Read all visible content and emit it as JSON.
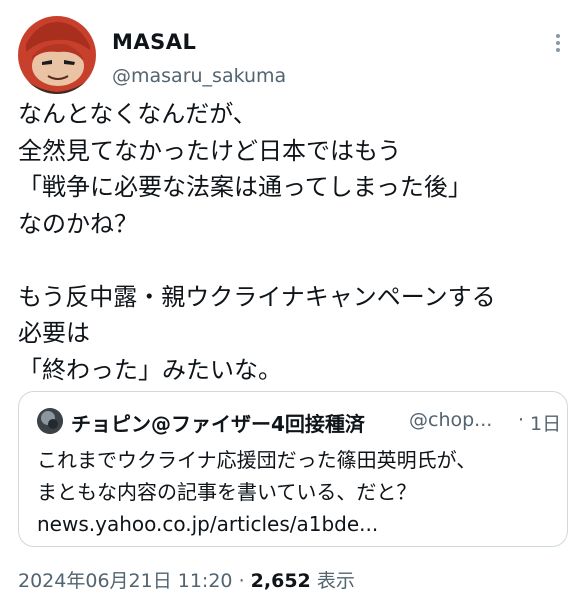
{
  "author": {
    "name": "MASAL",
    "handle": "@masaru_sakuma"
  },
  "tweet": {
    "lines": [
      "なんとなくなんだが、",
      "全然見てなかったけど日本ではもう",
      "「戦争に必要な法案は通ってしまった後」",
      "なのかね？",
      "",
      "もう反中露・親ウクライナキャンペーンする",
      "必要は",
      "「終わった」みたいな。"
    ]
  },
  "quote": {
    "name": "チョピン@ファイザー4回接種済",
    "handle": "@chop...",
    "separator": "·",
    "time": "1日",
    "lines": [
      "これまでウクライナ応援団だった篠田英明氏が、",
      "まともな内容の記事を書いている、だと？",
      "news.yahoo.co.jp/articles/a1bde..."
    ]
  },
  "meta": {
    "datetime": "2024年06月21日 11:20",
    "separator": "·",
    "views_count": "2,652",
    "views_label": "表示"
  },
  "icons": {
    "more": "more-options-icon",
    "avatar": "user-avatar",
    "quote_avatar": "quoted-user-avatar"
  },
  "colors": {
    "text": "#0f1419",
    "secondary": "#536471",
    "border": "#cfd9de"
  }
}
